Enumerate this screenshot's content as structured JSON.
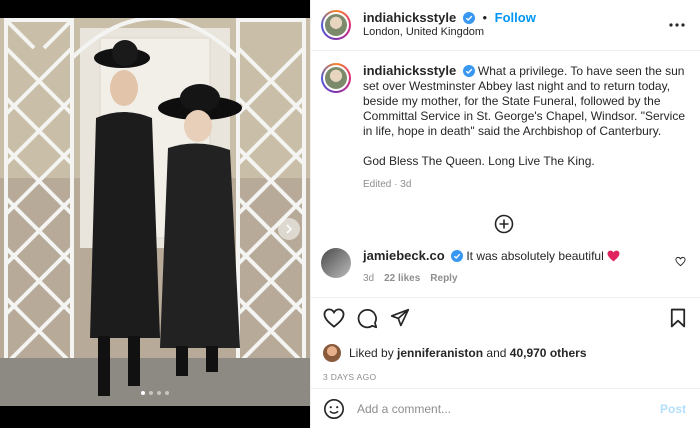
{
  "post": {
    "username": "indiahicksstyle",
    "follow_label": "Follow",
    "separator": "•",
    "location": "London, United Kingdom",
    "caption": "What a privilege. To have seen the sun set over Westminster Abbey last night and to return today, beside my mother, for the State Funeral, followed by the Committal Service in St. George's Chapel, Windsor. \"Service in life, hope in death\" said the Archbishop of Canterbury.\n\nGod Bless The Queen. Long Live The King.",
    "edited_label": "Edited",
    "edited_sep": "·",
    "caption_age": "3d",
    "carousel": {
      "count": 4,
      "active_index": 0
    }
  },
  "comments": [
    {
      "username": "jamiebeck.co",
      "text": "It was absolutely beautiful",
      "age": "3d",
      "likes": "22 likes",
      "reply_label": "Reply"
    }
  ],
  "likes": {
    "prefix": "Liked by",
    "user": "jenniferaniston",
    "joiner": "and",
    "count": "40,970 others"
  },
  "date": "3 DAYS AGO",
  "add_comment": {
    "placeholder": "Add a comment...",
    "post_label": "Post"
  },
  "colors": {
    "link_blue": "#0095f6",
    "post_disabled": "#b2dffc",
    "heart_red": "#ed4956",
    "muted": "#8e8e8e"
  },
  "icons": [
    "verified-badge-icon",
    "more-options-icon",
    "load-more-comments-icon",
    "heart-icon",
    "comment-icon",
    "share-icon",
    "save-icon",
    "emoji-icon",
    "chevron-right-icon",
    "red-heart-emoji"
  ]
}
